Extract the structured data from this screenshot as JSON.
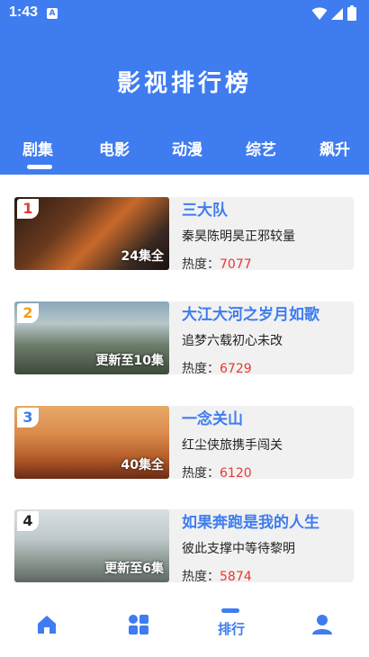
{
  "status_bar": {
    "time": "1:43",
    "app_icon_letter": "A"
  },
  "header": {
    "title": "影视排行榜"
  },
  "tabs": [
    {
      "label": "剧集",
      "active": true
    },
    {
      "label": "电影",
      "active": false
    },
    {
      "label": "动漫",
      "active": false
    },
    {
      "label": "综艺",
      "active": false
    },
    {
      "label": "飙升",
      "active": false
    }
  ],
  "items": [
    {
      "rank": "1",
      "rank_color": "#e53935",
      "episodes": "24集全",
      "title": "三大队",
      "desc": "秦昊陈明昊正邪较量",
      "heat_label": "热度：",
      "heat": "7077"
    },
    {
      "rank": "2",
      "rank_color": "#f39c12",
      "episodes": "更新至10集",
      "title": "大江大河之岁月如歌",
      "desc": "追梦六载初心未改",
      "heat_label": "热度：",
      "heat": "6729"
    },
    {
      "rank": "3",
      "rank_color": "#3f7cf0",
      "episodes": "40集全",
      "title": "一念关山",
      "desc": "红尘侠旅携手闯关",
      "heat_label": "热度：",
      "heat": "6120"
    },
    {
      "rank": "4",
      "rank_color": "#222222",
      "episodes": "更新至6集",
      "title": "如果奔跑是我的人生",
      "desc": "彼此支撑中等待黎明",
      "heat_label": "热度：",
      "heat": "5874"
    }
  ],
  "bottom_nav": {
    "home_icon": "home-icon",
    "category_icon": "grid-icon",
    "rank_label": "排行",
    "profile_icon": "person-icon"
  },
  "colors": {
    "accent": "#3f7cf0",
    "heat": "#e53935"
  }
}
